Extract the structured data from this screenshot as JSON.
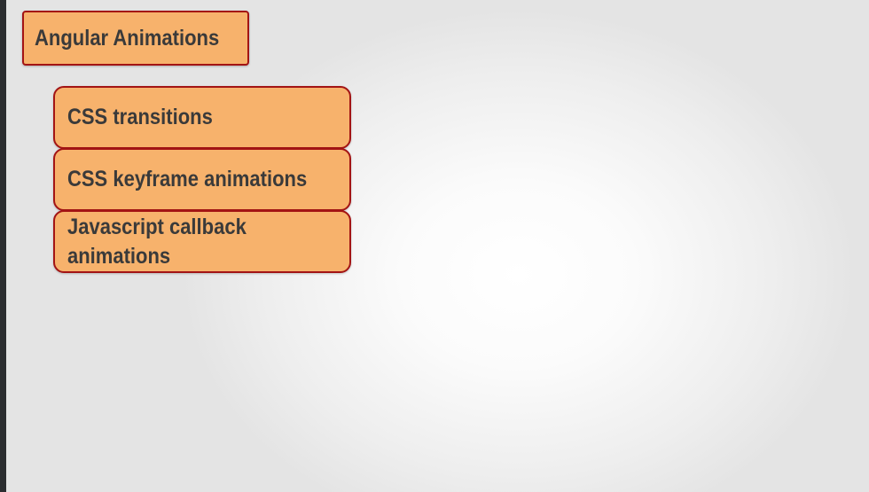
{
  "diagram": {
    "root": {
      "label": "Angular Animations"
    },
    "children": [
      {
        "label": "CSS transitions"
      },
      {
        "label": "CSS keyframe animations"
      },
      {
        "label": "Javascript callback animations"
      }
    ]
  },
  "colors": {
    "box_fill": "#f7b26c",
    "box_border": "#a31414",
    "text": "#3a3a3a"
  }
}
